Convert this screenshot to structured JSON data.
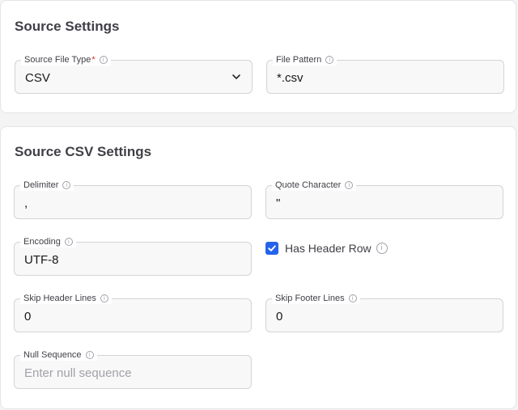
{
  "source_settings": {
    "title": "Source Settings",
    "file_type": {
      "label": "Source File Type",
      "required_mark": "*",
      "value": "CSV"
    },
    "file_pattern": {
      "label": "File Pattern",
      "value": "*.csv"
    }
  },
  "csv_settings": {
    "title": "Source CSV Settings",
    "delimiter": {
      "label": "Delimiter",
      "value": ","
    },
    "quote_character": {
      "label": "Quote Character",
      "value": "\""
    },
    "encoding": {
      "label": "Encoding",
      "value": "UTF-8"
    },
    "has_header_row": {
      "label": "Has Header Row",
      "checked": true
    },
    "skip_header_lines": {
      "label": "Skip Header Lines",
      "value": "0"
    },
    "skip_footer_lines": {
      "label": "Skip Footer Lines",
      "value": "0"
    },
    "null_sequence": {
      "label": "Null Sequence",
      "value": "",
      "placeholder": "Enter null sequence"
    }
  },
  "icons": {
    "info": "info-icon",
    "dropdown": "chevron-down-icon",
    "check": "check-icon"
  },
  "colors": {
    "accent": "#2563eb",
    "required": "#dc2626",
    "field_bg": "#f8f8f8",
    "border": "#d4d4d8"
  }
}
